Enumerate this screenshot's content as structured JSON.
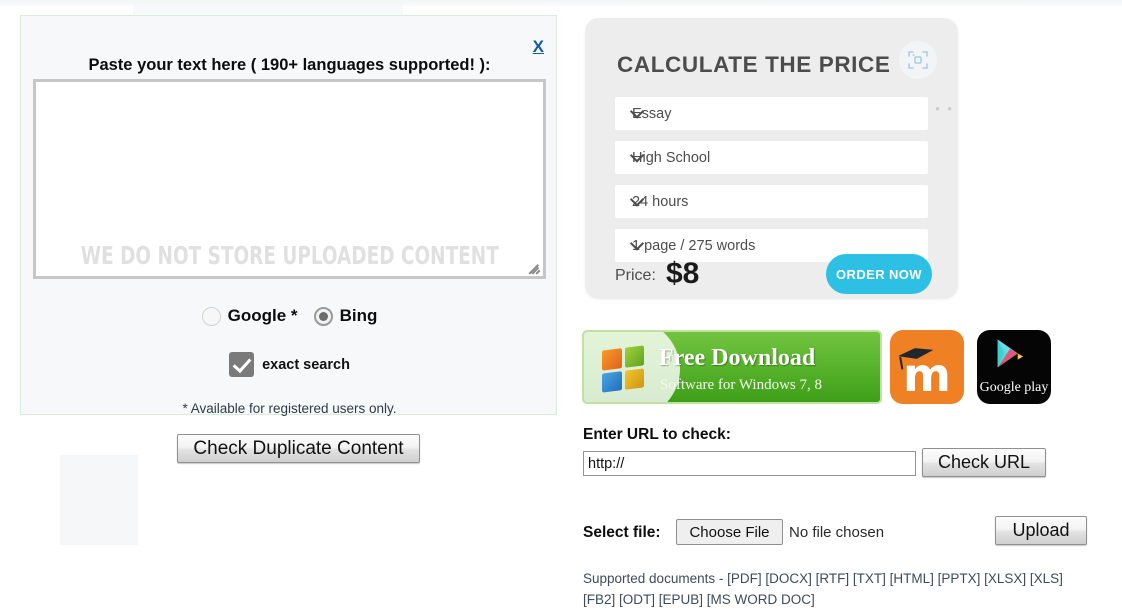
{
  "left_panel": {
    "close_label": "X",
    "paste_label": "Paste your text here ( 190+ languages supported! ):",
    "textarea_value": "",
    "watermark": "WE DO NOT STORE UPLOADED CONTENT",
    "engines": [
      {
        "label": "Google *",
        "checked": false
      },
      {
        "label": "Bing",
        "checked": true
      }
    ],
    "exact_search_label": "exact search",
    "exact_search_checked": true,
    "footnote": "* Available for registered users only.",
    "check_button": "Check Duplicate Content"
  },
  "calculator": {
    "title": "CALCULATE THE PRICE",
    "scan_icon": "scan-frame-icon",
    "dots": "• • •",
    "selects": [
      {
        "name": "paper-type",
        "value": "Essay"
      },
      {
        "name": "academic-level",
        "value": "High School"
      },
      {
        "name": "deadline",
        "value": "24 hours"
      },
      {
        "name": "pages",
        "value": "1 page / 275 words"
      }
    ],
    "price_label": "Price:",
    "price_value": "$8",
    "order_button": "ORDER NOW",
    "accent_color": "#2ec0e4"
  },
  "banners": {
    "green": {
      "icon": "windows-logo-icon",
      "title": "Free Download",
      "subtitle": "Software for Windows 7, 8",
      "color": "#57b32b"
    },
    "moodle": {
      "icon": "moodle-icon",
      "letter": "m"
    },
    "google_play": {
      "icon": "google-play-icon",
      "label": "Google play"
    }
  },
  "url_section": {
    "title": "Enter URL to check:",
    "input_value": "http://",
    "button": "Check URL"
  },
  "file_section": {
    "label": "Select file:",
    "choose_button": "Choose File",
    "status": "No file chosen",
    "upload_button": "Upload"
  },
  "supported_documents": "Supported documents - [PDF] [DOCX] [RTF] [TXT] [HTML] [PPTX] [XLSX] [XLS] [FB2] [ODT] [EPUB] [MS WORD DOC]"
}
